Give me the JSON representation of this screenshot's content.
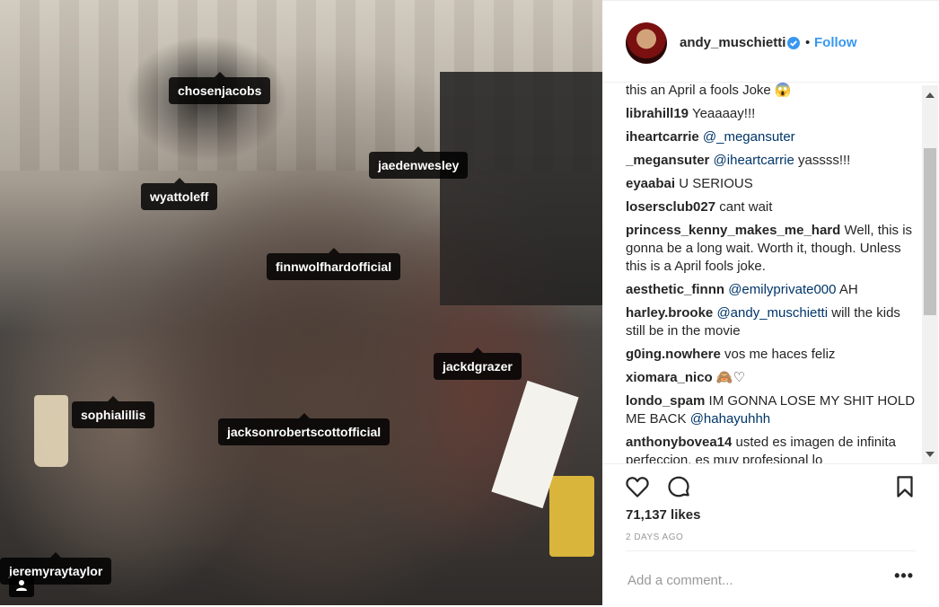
{
  "photo": {
    "tags": [
      {
        "id": "chosenjacobs",
        "label": "chosenjacobs"
      },
      {
        "id": "jaedenwesley",
        "label": "jaedenwesley"
      },
      {
        "id": "wyattoleff",
        "label": "wyattoleff"
      },
      {
        "id": "finnwolfhardofficial",
        "label": "finnwolfhardofficial"
      },
      {
        "id": "jackdgrazer",
        "label": "jackdgrazer"
      },
      {
        "id": "sophialillis",
        "label": "sophialillis"
      },
      {
        "id": "jacksonrobertscottofficial",
        "label": "jacksonrobertscottofficial"
      },
      {
        "id": "jeremyraytaylor",
        "label": "jeremyraytaylor"
      }
    ]
  },
  "header": {
    "username": "andy_muschietti",
    "separator": "•",
    "follow_label": "Follow",
    "verified_icon": "verified-badge-icon"
  },
  "comments": [
    {
      "user": "",
      "text": "this an April a fools Joke 😱"
    },
    {
      "user": "librahill19",
      "text": "Yeaaaay!!!"
    },
    {
      "user": "iheartcarrie",
      "mention": "@_megansuter",
      "text": ""
    },
    {
      "user": "_megansuter",
      "mention": "@iheartcarrie",
      "text": "yassss!!!"
    },
    {
      "user": "eyaabai",
      "text": "U SERIOUS"
    },
    {
      "user": "losersclub027",
      "text": "cant wait"
    },
    {
      "user": "princess_kenny_makes_me_hard",
      "text": "Well, this is gonna be a long wait. Worth it, though. Unless this is a April fools joke."
    },
    {
      "user": "aesthetic_finnn",
      "mention": "@emilyprivate000",
      "text": "AH"
    },
    {
      "user": "harley.brooke",
      "mention": "@andy_muschietti",
      "text": "will the kids still be in the movie"
    },
    {
      "user": "g0ing.nowhere",
      "text": "vos me haces feliz"
    },
    {
      "user": "xiomara_nico",
      "text": "🙈♡"
    },
    {
      "user": "londo_spam",
      "text": "IM GONNA LOSE MY SHIT HOLD ME BACK",
      "mention_after": "@hahayuhhh"
    },
    {
      "user": "anthonybovea14",
      "text": "usted es imagen de infinita perfeccion, es muy profesional lo"
    }
  ],
  "actions": {
    "like_icon": "heart-icon",
    "comment_icon": "comment-bubble-icon",
    "save_icon": "bookmark-icon"
  },
  "likes_text": "71,137 likes",
  "time_ago": "2 DAYS AGO",
  "add_comment": {
    "placeholder": "Add a comment...",
    "more_label": "•••"
  }
}
